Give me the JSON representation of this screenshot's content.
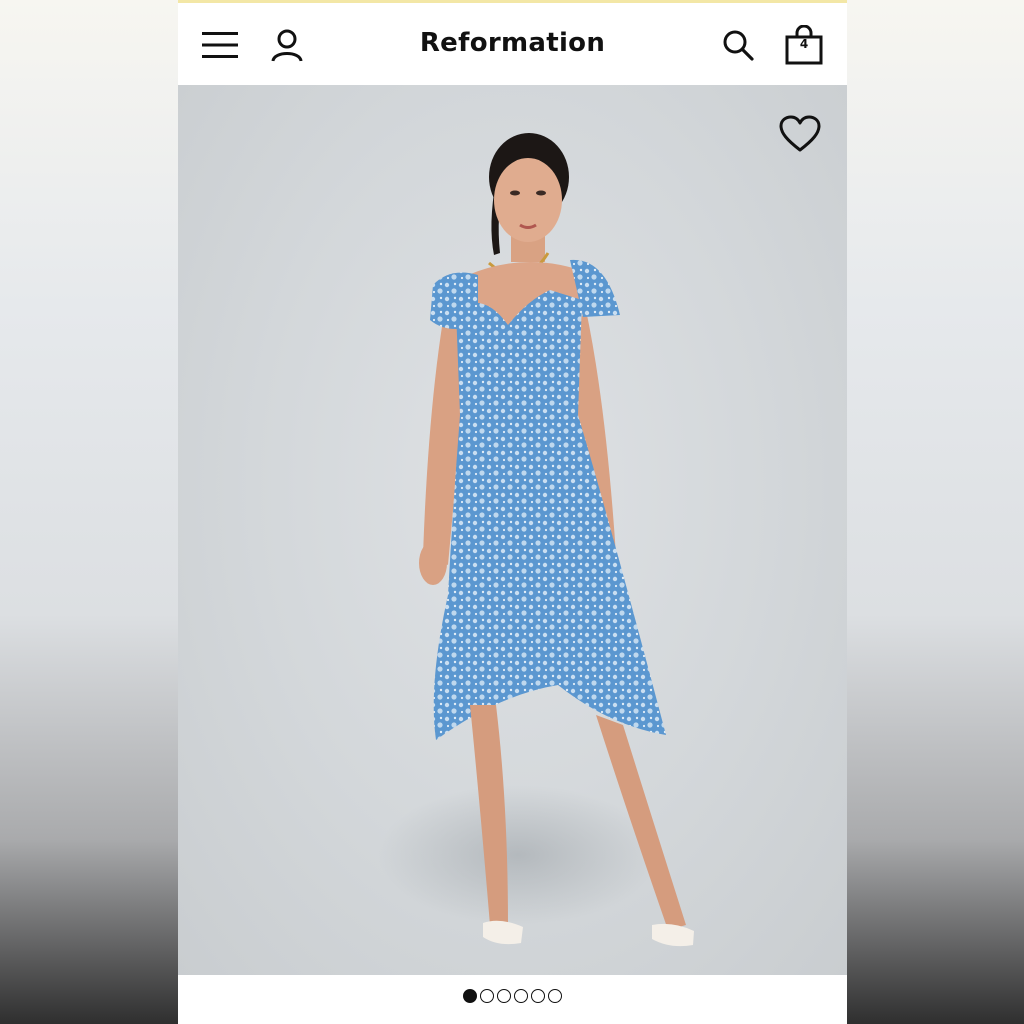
{
  "header": {
    "brand": "Reformation",
    "bag_count": "4",
    "icons": [
      "menu-icon",
      "account-icon",
      "search-icon",
      "bag-icon"
    ]
  },
  "hero": {
    "wishlist_icon": "heart-icon",
    "dress_color": "#5b97d0"
  },
  "carousel": {
    "total": 6,
    "active_index": 0
  },
  "colors": {
    "accent_strip": "#f3e7a6",
    "text": "#111111"
  }
}
